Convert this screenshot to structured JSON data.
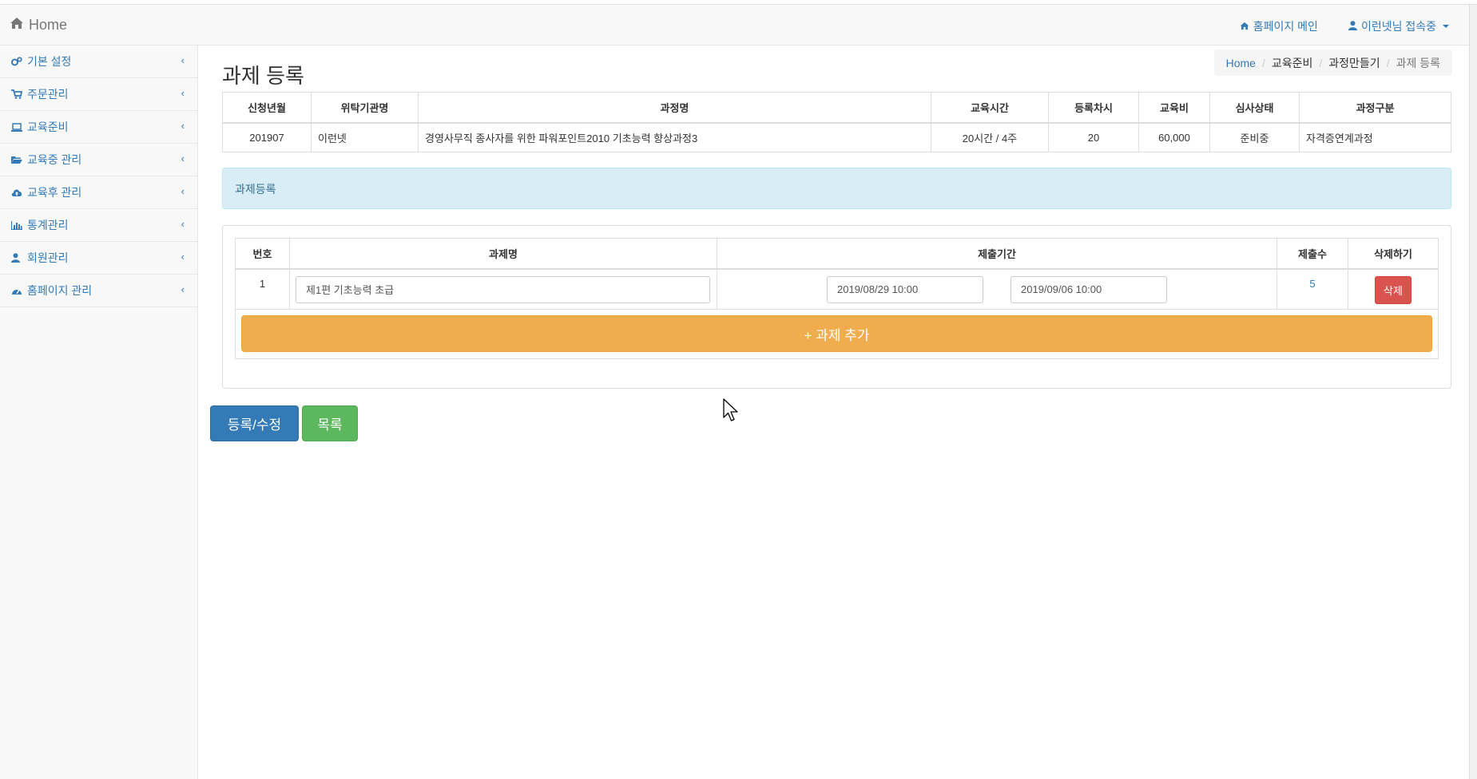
{
  "navbar": {
    "brand": "Home",
    "home_main_link": "홈페이지 메인",
    "user_menu": "이런넷님 접속중"
  },
  "sidebar": {
    "items": [
      {
        "label": "기본 설정",
        "icon": "gears-icon"
      },
      {
        "label": "주문관리",
        "icon": "cart-icon"
      },
      {
        "label": "교육준비",
        "icon": "laptop-icon"
      },
      {
        "label": "교육중 관리",
        "icon": "folder-open-icon"
      },
      {
        "label": "교육후 관리",
        "icon": "cloud-upload-icon"
      },
      {
        "label": "통계관리",
        "icon": "bar-chart-icon"
      },
      {
        "label": "회원관리",
        "icon": "user-icon"
      },
      {
        "label": "홈페이지 관리",
        "icon": "dashboard-icon"
      }
    ]
  },
  "page": {
    "title": "과제 등록",
    "breadcrumb": [
      "Home",
      "교육준비",
      "과정만들기",
      "과제 등록"
    ]
  },
  "course_table": {
    "headers": [
      "신청년월",
      "위탁기관명",
      "과정명",
      "교육시간",
      "등록차시",
      "교육비",
      "심사상태",
      "과정구분"
    ],
    "row": [
      "201907",
      "이런넷",
      "경영사무직 종사자를 위한 파워포인트2010 기초능력 향상과정3",
      "20시간 / 4주",
      "20",
      "60,000",
      "준비중",
      "자격증연계과정"
    ]
  },
  "alert": {
    "text": "과제등록"
  },
  "task_table": {
    "headers": [
      "번호",
      "과제명",
      "제출기간",
      "제출수",
      "삭제하기"
    ],
    "rows": [
      {
        "no": "1",
        "name": "제1편 기초능력 초급",
        "start": "2019/08/29 10:00",
        "end": "2019/09/06 10:00",
        "submissions": "5",
        "delete_label": "삭제"
      }
    ],
    "add_label": "+ 과제 추가"
  },
  "actions": {
    "save_label": "등록/수정",
    "list_label": "목록"
  },
  "colors": {
    "primary": "#337ab7",
    "success": "#5cb85c",
    "warning": "#f0ad4e",
    "danger": "#d9534f",
    "info_bg": "#d9edf7"
  }
}
